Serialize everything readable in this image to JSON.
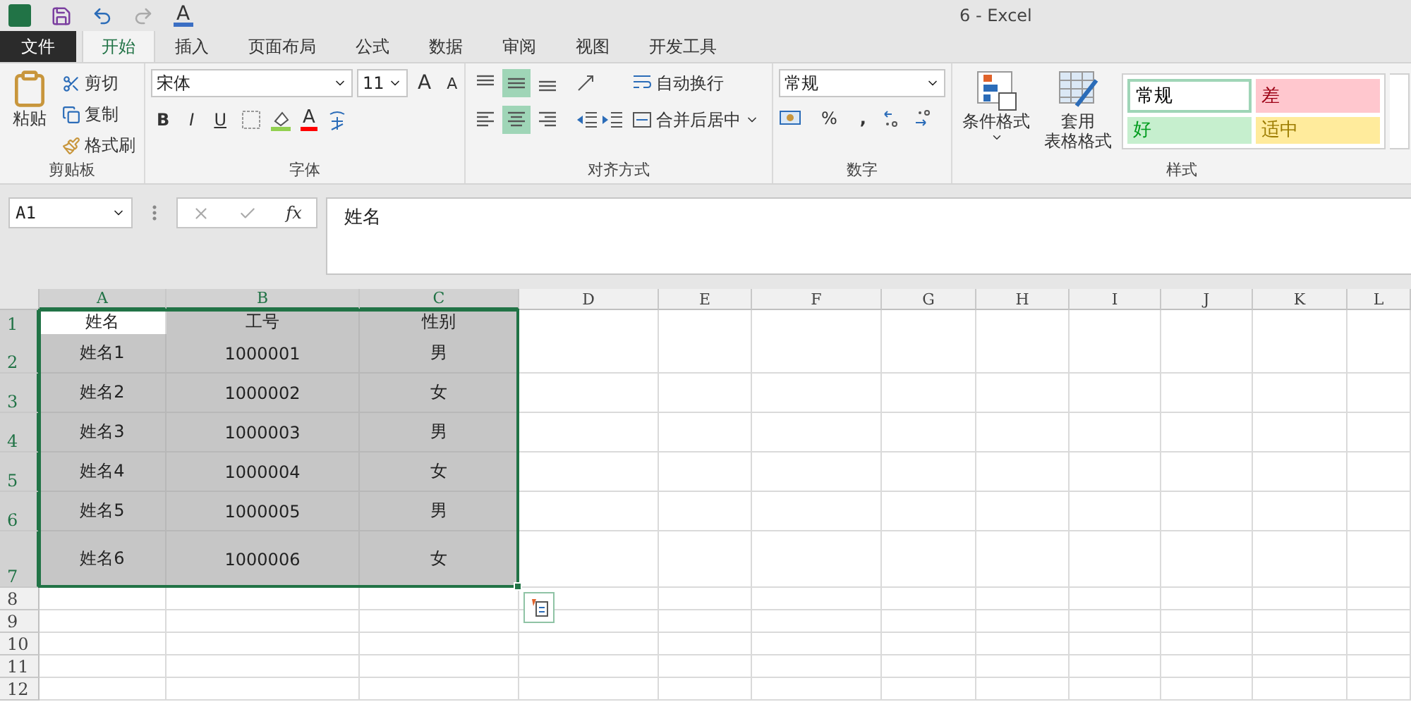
{
  "window": {
    "title": "6 - Excel"
  },
  "quick_access": {
    "font_color_letter": "A"
  },
  "tabs": [
    {
      "label": "文件",
      "kind": "file",
      "selected": false
    },
    {
      "label": "开始",
      "kind": "tab",
      "selected": true
    },
    {
      "label": "插入",
      "kind": "tab",
      "selected": false
    },
    {
      "label": "页面布局",
      "kind": "tab",
      "selected": false
    },
    {
      "label": "公式",
      "kind": "tab",
      "selected": false
    },
    {
      "label": "数据",
      "kind": "tab",
      "selected": false
    },
    {
      "label": "审阅",
      "kind": "tab",
      "selected": false
    },
    {
      "label": "视图",
      "kind": "tab",
      "selected": false
    },
    {
      "label": "开发工具",
      "kind": "tab",
      "selected": false
    }
  ],
  "ribbon": {
    "clipboard": {
      "label": "剪贴板",
      "paste": "粘贴",
      "cut": "剪切",
      "copy": "复制",
      "format_painter": "格式刷"
    },
    "font": {
      "label": "字体",
      "name": "宋体",
      "size": "11",
      "grow": "A",
      "shrink": "A",
      "bold": "B",
      "italic": "I",
      "underline": "U",
      "color_letter": "A"
    },
    "alignment": {
      "label": "对齐方式",
      "vertical": [
        {
          "kind": "top",
          "selected": false
        },
        {
          "kind": "middle",
          "selected": true
        },
        {
          "kind": "bottom",
          "selected": false
        }
      ],
      "horizontal": [
        {
          "kind": "left",
          "selected": false
        },
        {
          "kind": "center",
          "selected": true
        },
        {
          "kind": "right",
          "selected": false
        }
      ],
      "wrap_text": "自动换行",
      "merge_center": "合并后居中"
    },
    "number": {
      "label": "数字",
      "format": "常规",
      "percent": "%",
      "comma": ","
    },
    "styles": {
      "label": "样式",
      "conditional": "条件格式",
      "table_lines": [
        "套用",
        "表格格式"
      ],
      "cells": [
        {
          "label": "常规",
          "color": "#ffffff",
          "selected": true
        },
        {
          "label": "差",
          "color": "#ffc7ce",
          "selected": false
        },
        {
          "label": "好",
          "color": "#c6efce",
          "selected": false
        },
        {
          "label": "适中",
          "color": "#ffeb9c",
          "selected": false
        }
      ]
    }
  },
  "formula_bar": {
    "name_box": "A1",
    "function_label": "fx",
    "value": "姓名"
  },
  "sheet": {
    "columns": [
      {
        "label": "A",
        "selected": true
      },
      {
        "label": "B",
        "selected": true
      },
      {
        "label": "C",
        "selected": true
      },
      {
        "label": "D",
        "selected": false
      },
      {
        "label": "E",
        "selected": false
      },
      {
        "label": "F",
        "selected": false
      },
      {
        "label": "G",
        "selected": false
      },
      {
        "label": "H",
        "selected": false
      },
      {
        "label": "I",
        "selected": false
      },
      {
        "label": "J",
        "selected": false
      },
      {
        "label": "K",
        "selected": false
      },
      {
        "label": "L",
        "selected": false
      }
    ],
    "rows": [
      {
        "label": "1",
        "selected": true,
        "cells": [
          {
            "text": "姓名",
            "selected": false
          },
          {
            "text": "工号",
            "selected": true
          },
          {
            "text": "性别",
            "selected": true
          }
        ]
      },
      {
        "label": "2",
        "selected": true,
        "cells": [
          {
            "text": "姓名1",
            "selected": true
          },
          {
            "text": "1000001",
            "selected": true
          },
          {
            "text": "男",
            "selected": true
          }
        ]
      },
      {
        "label": "3",
        "selected": true,
        "cells": [
          {
            "text": "姓名2",
            "selected": true
          },
          {
            "text": "1000002",
            "selected": true
          },
          {
            "text": "女",
            "selected": true
          }
        ]
      },
      {
        "label": "4",
        "selected": true,
        "cells": [
          {
            "text": "姓名3",
            "selected": true
          },
          {
            "text": "1000003",
            "selected": true
          },
          {
            "text": "男",
            "selected": true
          }
        ]
      },
      {
        "label": "5",
        "selected": true,
        "cells": [
          {
            "text": "姓名4",
            "selected": true
          },
          {
            "text": "1000004",
            "selected": true
          },
          {
            "text": "女",
            "selected": true
          }
        ]
      },
      {
        "label": "6",
        "selected": true,
        "cells": [
          {
            "text": "姓名5",
            "selected": true
          },
          {
            "text": "1000005",
            "selected": true
          },
          {
            "text": "男",
            "selected": true
          }
        ]
      },
      {
        "label": "7",
        "selected": true,
        "cells": [
          {
            "text": "姓名6",
            "selected": true
          },
          {
            "text": "1000006",
            "selected": true
          },
          {
            "text": "女",
            "selected": true
          }
        ]
      },
      {
        "label": "8",
        "selected": false,
        "cells": []
      },
      {
        "label": "9",
        "selected": false,
        "cells": []
      },
      {
        "label": "10",
        "selected": false,
        "cells": []
      },
      {
        "label": "11",
        "selected": false,
        "cells": []
      },
      {
        "label": "12",
        "selected": false,
        "cells": []
      }
    ]
  }
}
